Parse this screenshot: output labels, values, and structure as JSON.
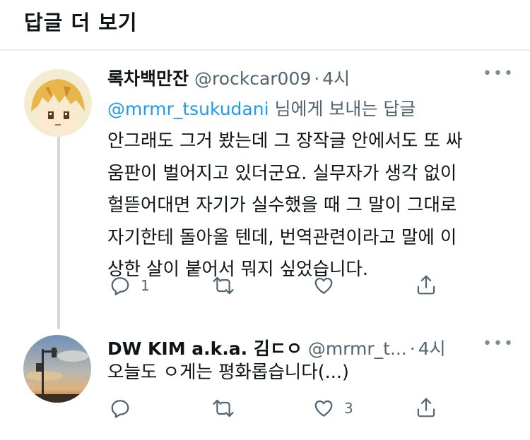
{
  "header": {
    "title": "답글 더 보기"
  },
  "tweets": [
    {
      "name": "록차백만잔",
      "handle": "@rockcar009",
      "separator": "·",
      "time": "4시",
      "reply_to_handle": "@mrmr_tsukudani",
      "reply_to_suffix": " 님에게 보내는 답글",
      "body_lines": [
        "안그래도 그거 봤는데 그 장작글 안에서도 또 싸",
        "움판이 벌어지고 있더군요. 실무자가 생각 없이",
        "헐뜯어대면 자기가 실수했을 때 그 말이 그대로",
        "자기한테 돌아올 텐데, 번역관련이라고 말에 이",
        "상한 살이 붙어서 뭐지 싶었습니다."
      ],
      "actions": {
        "reply_count": "1",
        "retweet_count": "",
        "like_count": ""
      }
    },
    {
      "name": "DW KIM a.k.a. 김ㄷㅇ",
      "handle": "@mrmr_t...",
      "separator": "·",
      "time": "4시",
      "body_lines": [
        "오늘도 ㅇ게는 평화롭습니다(...)"
      ],
      "actions": {
        "reply_count": "",
        "retweet_count": "",
        "like_count": "3"
      }
    }
  ],
  "colors": {
    "link": "#1d9bf0",
    "secondary": "#536471",
    "divider": "#e9eef1"
  }
}
